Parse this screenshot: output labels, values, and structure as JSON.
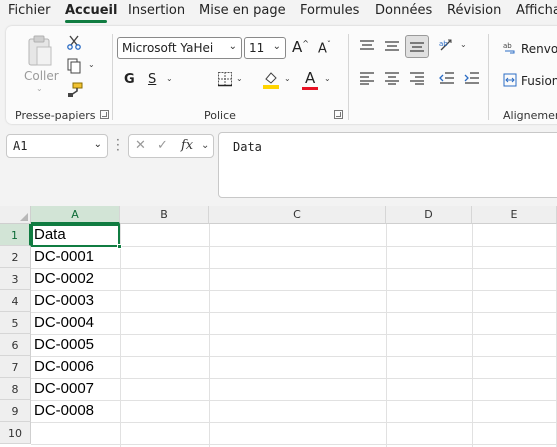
{
  "menu": {
    "tabs": [
      "Fichier",
      "Accueil",
      "Insertion",
      "Mise en page",
      "Formules",
      "Données",
      "Révision",
      "Affichage"
    ],
    "active": "Accueil"
  },
  "ribbon": {
    "clipboard": {
      "paste_label": "Coller",
      "group_label": "Presse-papiers"
    },
    "font": {
      "font_name": "Microsoft YaHei",
      "font_size": "11",
      "bold": "G",
      "underline": "S",
      "font_color_letter": "A",
      "group_label": "Police",
      "highlight_color": "#ffd400",
      "font_color": "#e81123"
    },
    "alignment": {
      "wrap_label": "Renvoyer",
      "merge_label": "Fusionner",
      "group_label": "Alignement"
    }
  },
  "formula_bar": {
    "name_box": "A1",
    "fx_symbol": "fx",
    "content": "Data"
  },
  "sheet": {
    "columns": [
      "A",
      "B",
      "C",
      "D",
      "E"
    ],
    "rows": [
      "1",
      "2",
      "3",
      "4",
      "5",
      "6",
      "7",
      "8",
      "9",
      "10"
    ],
    "cells_A": [
      "Data",
      "DC-0001",
      "DC-0002",
      "DC-0003",
      "DC-0004",
      "DC-0005",
      "DC-0006",
      "DC-0007",
      "DC-0008",
      ""
    ],
    "active_cell": "A1"
  },
  "colors": {
    "accent": "#107c41"
  }
}
